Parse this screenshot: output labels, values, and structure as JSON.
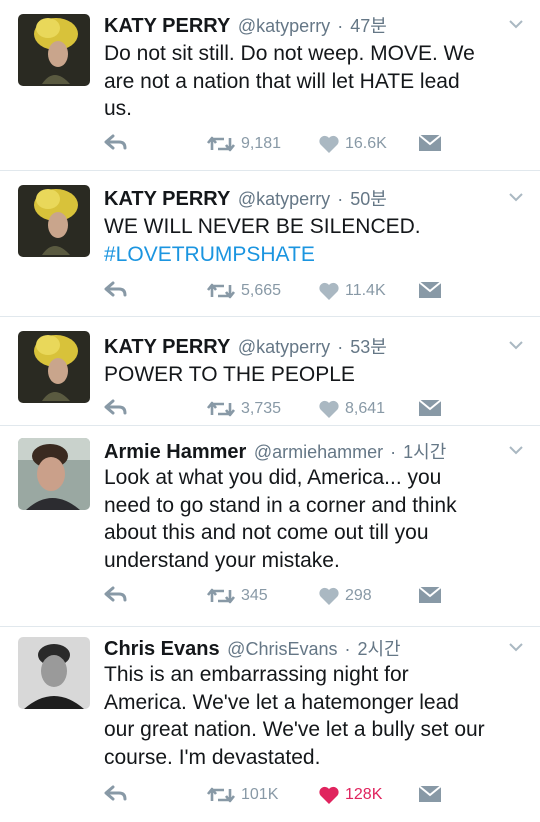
{
  "tweets": [
    {
      "name": "KATY PERRY",
      "handle": "@katyperry",
      "time": "47분",
      "lines": [
        "Do not sit still. Do not weep. MOVE. We",
        "are not a nation that will let HATE lead",
        "us."
      ],
      "retweets": "9,181",
      "likes": "16.6K",
      "liked": false
    },
    {
      "name": "KATY PERRY",
      "handle": "@katyperry",
      "time": "50분",
      "lines": [
        "WE WILL NEVER BE SILENCED."
      ],
      "hashtag": "#LOVETRUMPSHATE",
      "retweets": "5,665",
      "likes": "11.4K",
      "liked": false
    },
    {
      "name": "KATY PERRY",
      "handle": "@katyperry",
      "time": "53분",
      "lines": [
        "POWER TO THE PEOPLE"
      ],
      "retweets": "3,735",
      "likes": "8,641",
      "liked": false
    },
    {
      "name": "Armie Hammer",
      "handle": "@armiehammer",
      "time": "1시간",
      "lines": [
        "Look at what you did, America... you",
        "need to go stand in a corner and think",
        "about this and not come out till you",
        "understand your mistake."
      ],
      "retweets": "345",
      "likes": "298",
      "liked": false
    },
    {
      "name": "Chris Evans",
      "handle": "@ChrisEvans",
      "time": "2시간",
      "lines": [
        "This is an embarrassing night for",
        "America. We've let a hatemonger lead",
        "our great nation. We've let a bully set our",
        "course. I'm devastated."
      ],
      "retweets": "101K",
      "likes": "128K",
      "liked": true
    }
  ],
  "colors": {
    "text": "#14171a",
    "secondary": "#657786",
    "action_gray": "#8899a6",
    "hashtag_blue": "#1b95e0",
    "liked_red": "#e0245e",
    "separator": "#e1e8ed"
  },
  "icons": [
    "reply-icon",
    "retweet-icon",
    "like-icon",
    "direct-message-icon",
    "chevron-down-icon"
  ]
}
